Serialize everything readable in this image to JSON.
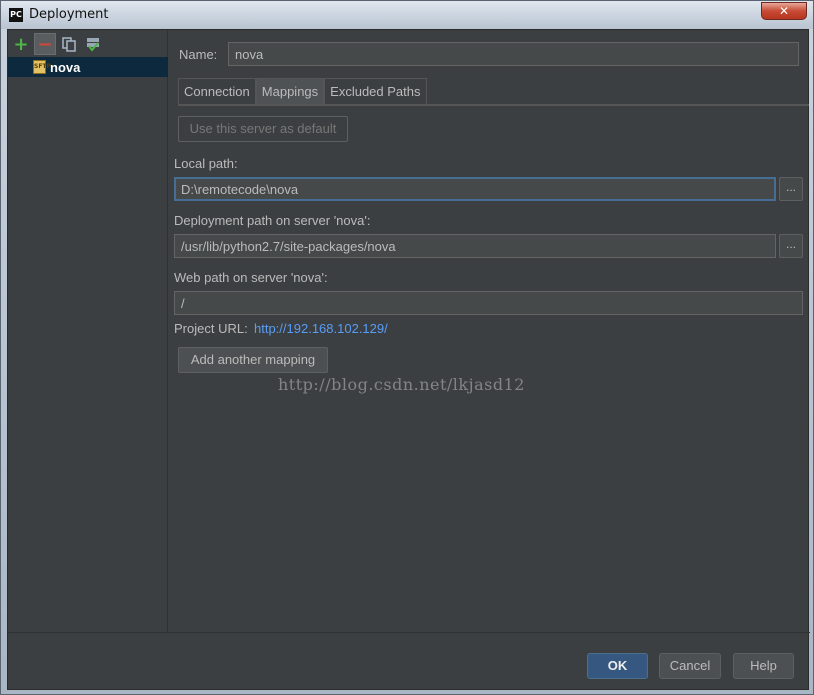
{
  "window": {
    "title": "Deployment",
    "icon_text": "PC",
    "close_glyph": "✕"
  },
  "sidebar": {
    "toolbar": [
      {
        "name": "add-icon",
        "glyph": "+"
      },
      {
        "name": "remove-icon",
        "glyph": "−"
      },
      {
        "name": "copy-icon"
      },
      {
        "name": "use-as-default-icon"
      }
    ],
    "servers": [
      {
        "label": "nova",
        "icon": "sftp-server-icon",
        "icon_text": "SFTP",
        "selected": true
      }
    ]
  },
  "main": {
    "name_label": "Name:",
    "name_value": "nova",
    "tabs": [
      {
        "label": "Connection",
        "active": false
      },
      {
        "label": "Mappings",
        "active": true
      },
      {
        "label": "Excluded Paths",
        "active": false
      }
    ],
    "use_default_button": "Use this server as default",
    "local_path_label": "Local path:",
    "local_path_value": "D:\\remotecode\\nova",
    "deployment_path_label": "Deployment path on server 'nova':",
    "deployment_path_value": "/usr/lib/python2.7/site-packages/nova",
    "web_path_label": "Web path on server 'nova':",
    "web_path_value": "/",
    "browse_label": "...",
    "project_url_label": "Project URL:",
    "project_url_value": "http://192.168.102.129/",
    "add_mapping_button": "Add another mapping"
  },
  "watermark": "http://blog.csdn.net/lkjasd12",
  "footer": {
    "ok": "OK",
    "cancel": "Cancel",
    "help": "Help"
  },
  "colors": {
    "background": "#3c3f41",
    "selection": "#0d293e",
    "link": "#589df6",
    "ok_button": "#365880"
  }
}
